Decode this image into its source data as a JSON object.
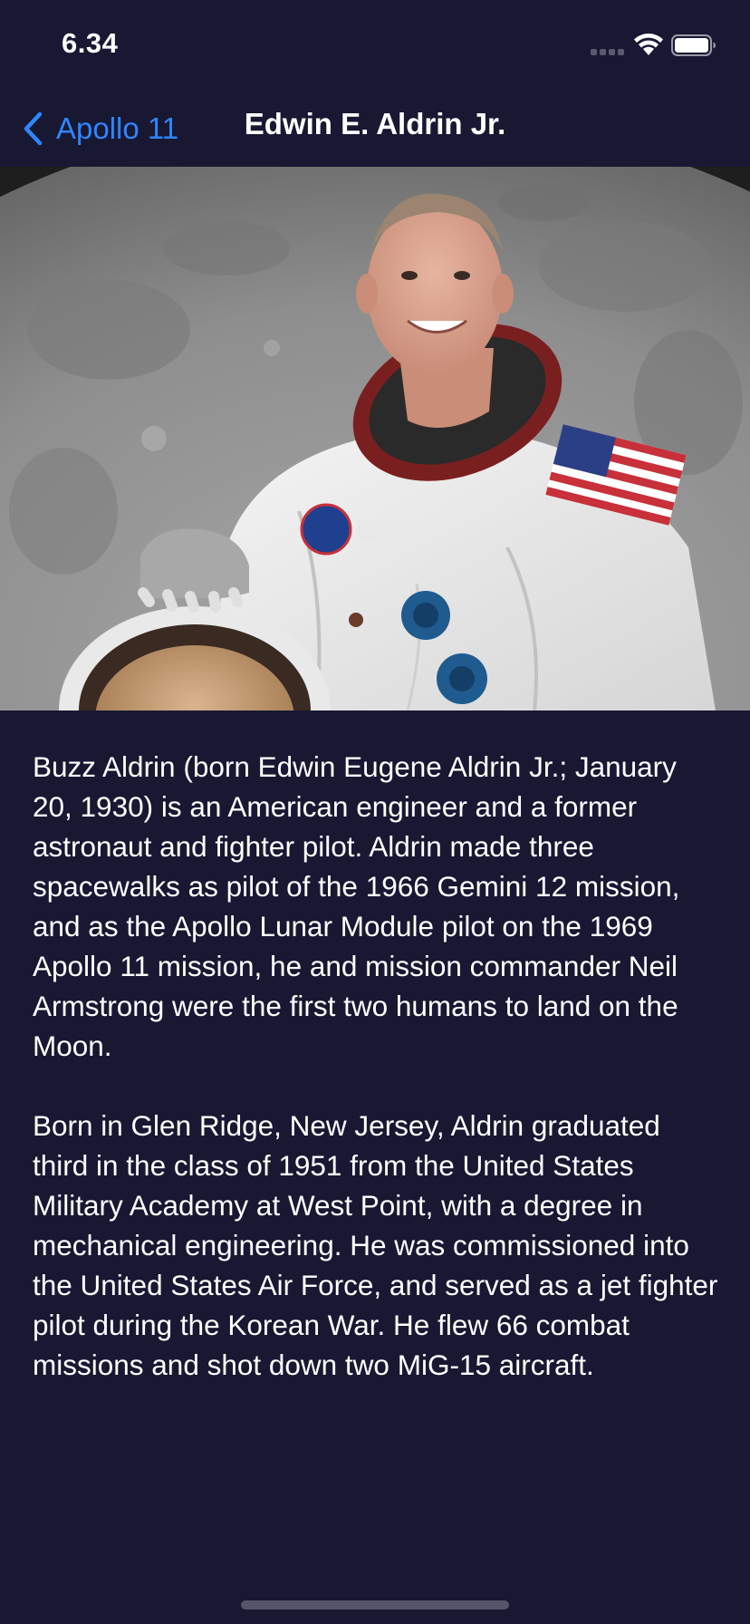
{
  "status_bar": {
    "time": "6.34",
    "icons": [
      "cellular-signal-icon",
      "wifi-icon",
      "battery-icon"
    ]
  },
  "nav": {
    "back_label": "Apollo 11",
    "back_icon": "chevron-left-icon",
    "title": "Edwin E. Aldrin Jr."
  },
  "hero": {
    "image": "astronaut-portrait"
  },
  "bio": {
    "paragraphs": [
      "Buzz Aldrin (born Edwin Eugene Aldrin Jr.; January 20, 1930) is an American engineer and a former astronaut and fighter pilot. Aldrin made three spacewalks as pilot of the 1966 Gemini 12 mission, and as the Apollo Lunar Module pilot on the 1969 Apollo 11 mission, he and mission commander Neil Armstrong were the first two humans to land on the Moon.",
      "Born in Glen Ridge, New Jersey, Aldrin graduated third in the class of 1951 from the United States Military Academy at West Point, with a degree in mechanical engineering. He was commissioned into the United States Air Force, and served as a jet fighter pilot during the Korean War. He flew 66 combat missions and shot down two MiG-15 aircraft."
    ]
  },
  "colors": {
    "background": "#181833",
    "accent": "#2f86ff",
    "text": "#ffffff"
  }
}
